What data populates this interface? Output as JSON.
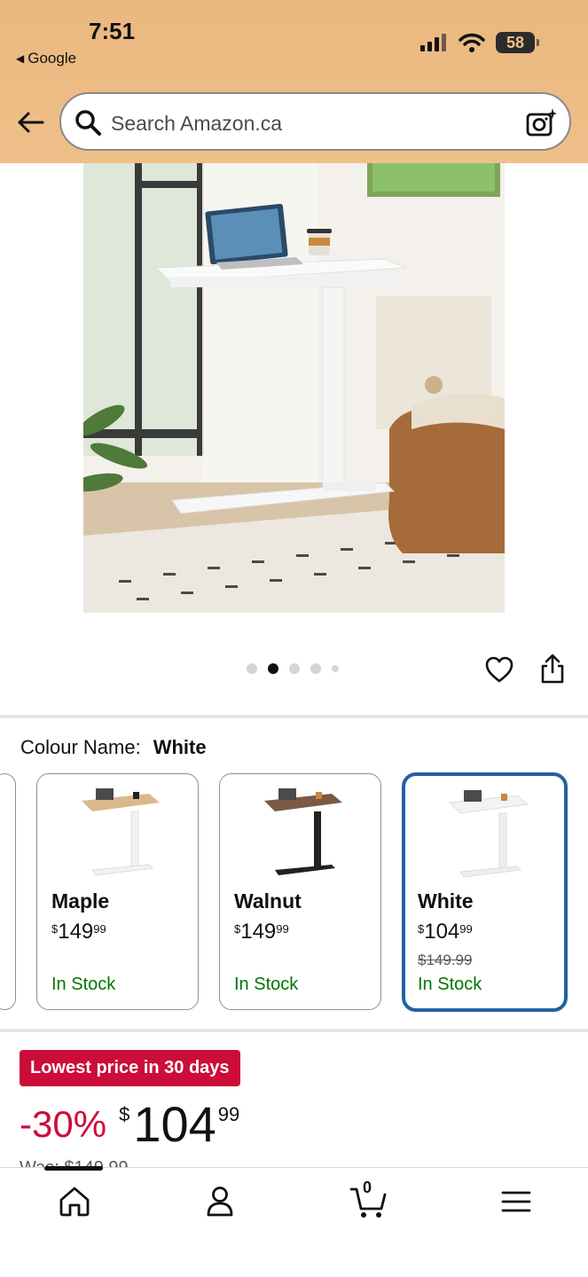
{
  "status_bar": {
    "time": "7:51",
    "back_app": "Google",
    "battery": "58"
  },
  "search": {
    "placeholder": "Search Amazon.ca"
  },
  "carousel": {
    "total_dots": 5,
    "active_index": 1
  },
  "colour": {
    "label": "Colour Name:",
    "selected": "White"
  },
  "swatches": [
    {
      "name": "Maple",
      "currency": "$",
      "whole": "149",
      "fraction": "99",
      "was": "",
      "stock": "In Stock",
      "top_color": "#d8b98c",
      "leg_color": "#f2f2f2",
      "selected": false
    },
    {
      "name": "Walnut",
      "currency": "$",
      "whole": "149",
      "fraction": "99",
      "was": "",
      "stock": "In Stock",
      "top_color": "#7a5a44",
      "leg_color": "#222222",
      "selected": false
    },
    {
      "name": "White",
      "currency": "$",
      "whole": "104",
      "fraction": "99",
      "was": "$149.99",
      "stock": "In Stock",
      "top_color": "#f3f3f3",
      "leg_color": "#eeeeee",
      "selected": true
    }
  ],
  "deal": {
    "badge": "Lowest price in 30 days",
    "discount": "-30%",
    "currency": "$",
    "whole": "104",
    "fraction": "99",
    "was": "Was: $149.99"
  },
  "bottom_nav": {
    "cart_count": "0",
    "active": "home"
  },
  "colors": {
    "header_bg": "#eab77f",
    "deal_red": "#cc0c39",
    "stock_green": "#007600",
    "selected_border": "#2162a1"
  }
}
